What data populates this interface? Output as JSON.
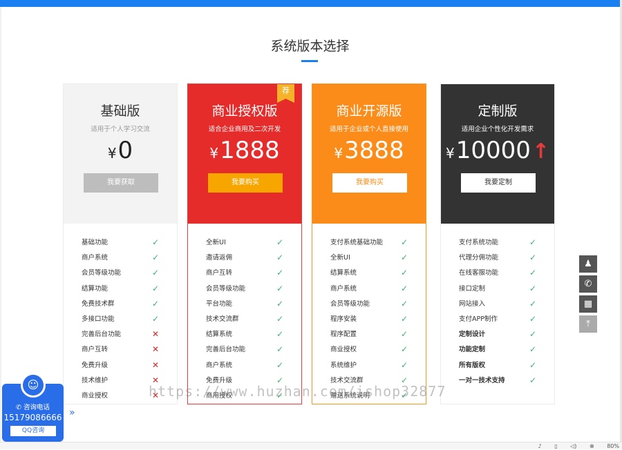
{
  "section": {
    "title": "系统版本选择"
  },
  "plans": [
    {
      "name": "基础版",
      "desc": "适用于个人学习交流",
      "currency": "¥",
      "price": "0",
      "button": "我要获取",
      "features": [
        {
          "label": "基础功能",
          "ok": true
        },
        {
          "label": "商户系统",
          "ok": true
        },
        {
          "label": "会员等级功能",
          "ok": true
        },
        {
          "label": "结算功能",
          "ok": true
        },
        {
          "label": "免费技术群",
          "ok": true
        },
        {
          "label": "多接口功能",
          "ok": true
        },
        {
          "label": "完善后台功能",
          "ok": false
        },
        {
          "label": "商户互转",
          "ok": false
        },
        {
          "label": "免费升级",
          "ok": false
        },
        {
          "label": "技术维护",
          "ok": false
        },
        {
          "label": "商业授权",
          "ok": false
        }
      ]
    },
    {
      "name": "商业授权版",
      "desc": "适合企业商用及二次开发",
      "currency": "¥",
      "price": "1888",
      "button": "我要购买",
      "badge": "荐",
      "features": [
        {
          "label": "全新UI",
          "ok": true
        },
        {
          "label": "邀请返佣",
          "ok": true
        },
        {
          "label": "商户互转",
          "ok": true
        },
        {
          "label": "会员等级功能",
          "ok": true
        },
        {
          "label": "平台功能",
          "ok": true
        },
        {
          "label": "技术交流群",
          "ok": true
        },
        {
          "label": "结算系统",
          "ok": true
        },
        {
          "label": "完善后台功能",
          "ok": true
        },
        {
          "label": "商户系统",
          "ok": true
        },
        {
          "label": "免费升级",
          "ok": true
        },
        {
          "label": "商用授权",
          "ok": true
        }
      ]
    },
    {
      "name": "商业开源版",
      "desc": "适用于企业或个人直接使用",
      "currency": "¥",
      "price": "3888",
      "button": "我要购买",
      "features": [
        {
          "label": "支付系统基础功能",
          "ok": true
        },
        {
          "label": "全新UI",
          "ok": true
        },
        {
          "label": "结算系统",
          "ok": true
        },
        {
          "label": "商户系统",
          "ok": true
        },
        {
          "label": "会员等级功能",
          "ok": true
        },
        {
          "label": "程序安装",
          "ok": true
        },
        {
          "label": "程序配置",
          "ok": true
        },
        {
          "label": "商业授权",
          "ok": true
        },
        {
          "label": "系统维护",
          "ok": true
        },
        {
          "label": "技术交流群",
          "ok": true
        },
        {
          "label": "赠送系统说明",
          "ok": true
        }
      ]
    },
    {
      "name": "定制版",
      "desc": "适用企业个性化开发需求",
      "currency": "¥",
      "price": "10000",
      "button": "我要定制",
      "features": [
        {
          "label": "支付系统功能",
          "ok": true,
          "bold": false
        },
        {
          "label": "代理分佣功能",
          "ok": true,
          "bold": false
        },
        {
          "label": "在线客服功能",
          "ok": true,
          "bold": false
        },
        {
          "label": "接口定制",
          "ok": true,
          "bold": false
        },
        {
          "label": "网站接入",
          "ok": true,
          "bold": false
        },
        {
          "label": "支付APP制作",
          "ok": true,
          "bold": false
        },
        {
          "label": "定制设计",
          "ok": true,
          "bold": true
        },
        {
          "label": "功能定制",
          "ok": true,
          "bold": true
        },
        {
          "label": "所有版权",
          "ok": true,
          "bold": true
        },
        {
          "label": "一对一技术支持",
          "ok": true,
          "bold": true
        }
      ]
    }
  ],
  "side_tools": [
    {
      "name": "qq-tool",
      "glyph": "♟"
    },
    {
      "name": "phone-tool",
      "glyph": "✆"
    },
    {
      "name": "qrcode-tool",
      "glyph": "▦"
    },
    {
      "name": "back-to-top-tool",
      "glyph": "⤒"
    }
  ],
  "consult": {
    "label": "咨询电话",
    "phone": "15179086666",
    "qq_button": "QQ咨询"
  },
  "watermark": "https://www.huzhan.com/ishop32877",
  "statusbar": {
    "zoom": "80%"
  },
  "colors": {
    "accent": "#1a7ff0",
    "red": "#e62b2b",
    "orange": "#fb8c1a",
    "dark": "#333333",
    "check": "#3cb371",
    "cross": "#e02424"
  }
}
